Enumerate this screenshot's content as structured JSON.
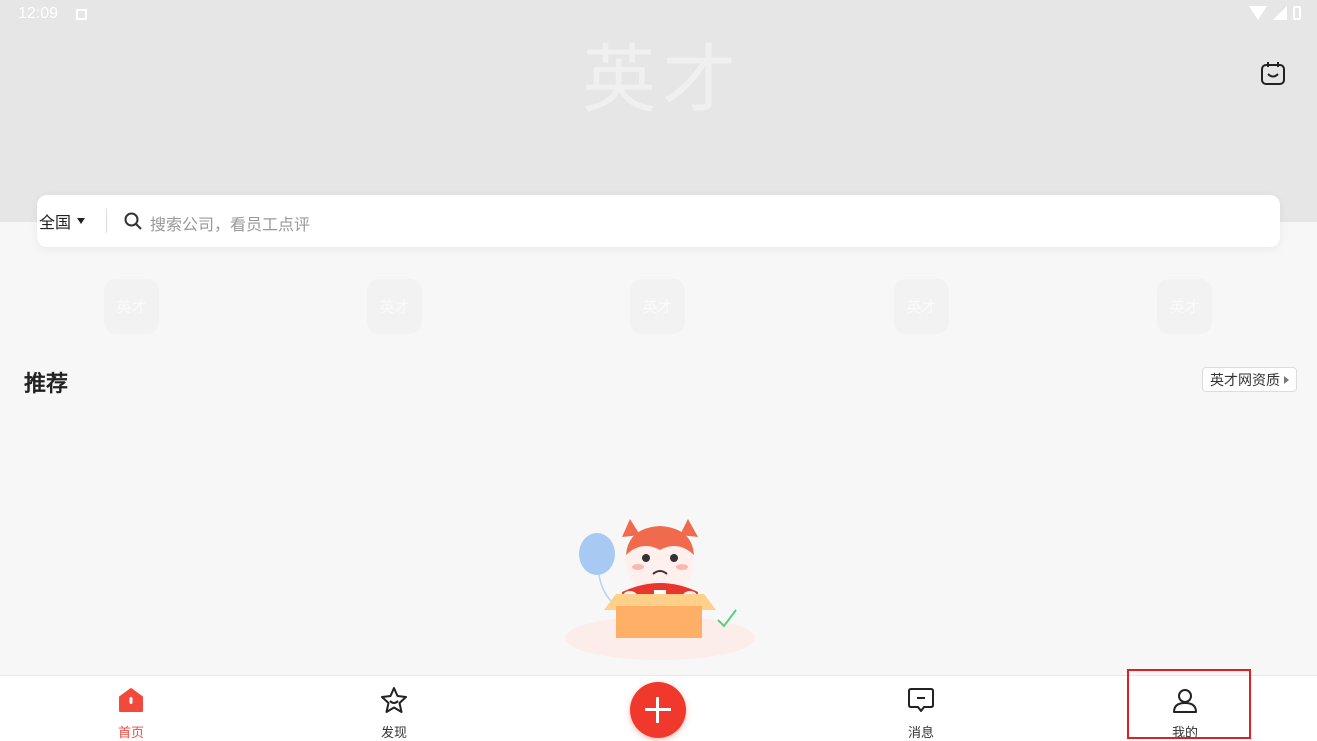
{
  "status_bar": {
    "time": "12:09"
  },
  "header": {
    "logo_text": "英才"
  },
  "search": {
    "region": "全国",
    "placeholder": "搜索公司，看员工点评"
  },
  "shortcuts": [
    "英才",
    "英才",
    "英才",
    "英才",
    "英才"
  ],
  "recommend": {
    "title": "推荐",
    "qualification_label": "英才网资质"
  },
  "bottom_nav": {
    "items": [
      {
        "label": "首页",
        "icon": "home-icon",
        "active": true
      },
      {
        "label": "发现",
        "icon": "star-icon"
      },
      {
        "label": "消息",
        "icon": "message-icon"
      },
      {
        "label": "我的",
        "icon": "user-icon"
      }
    ]
  },
  "colors": {
    "accent": "#f0392c",
    "active_tab": "#f2493d",
    "header_bg": "#e6e6e6"
  }
}
